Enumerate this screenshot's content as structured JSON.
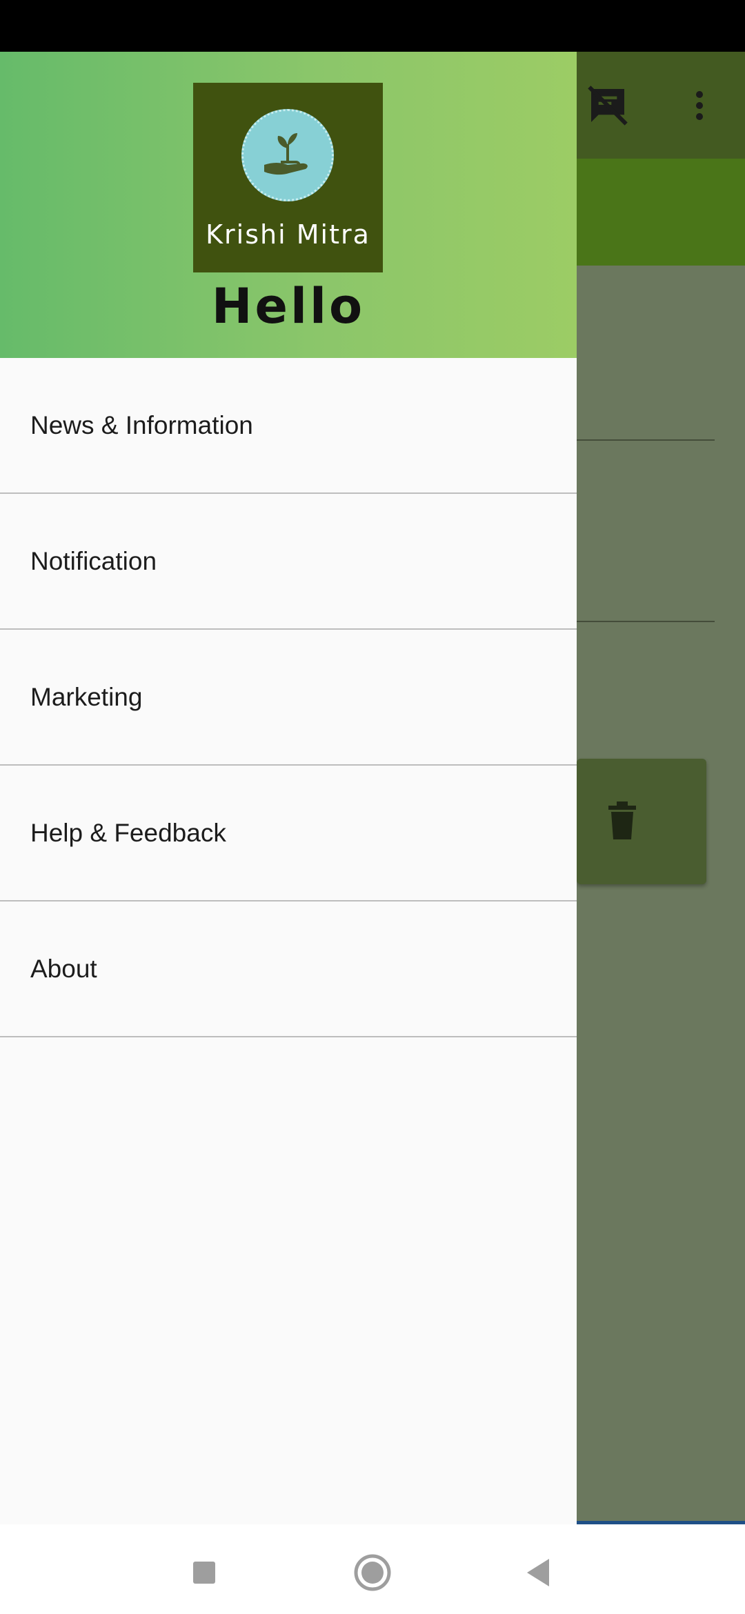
{
  "app": {
    "logo_text": "Krishi Mitra",
    "greeting": "Hello"
  },
  "drawer": {
    "items": [
      {
        "label": "News & Information"
      },
      {
        "label": "Notification"
      },
      {
        "label": "Marketing"
      },
      {
        "label": "Help & Feedback"
      },
      {
        "label": "About"
      }
    ]
  },
  "toolbar": {
    "icons": [
      "speaker-notes-off-icon",
      "more-vert-icon"
    ]
  },
  "background": {
    "icons": [
      "delete-icon"
    ]
  },
  "navigation": {
    "icons": [
      "recents-square-icon",
      "home-circle-icon",
      "back-triangle-icon"
    ]
  },
  "colors": {
    "header_gradient_start": "#66bb6a",
    "header_gradient_end": "#9ccc65",
    "toolbar": "#435a21",
    "band": "#4a7518",
    "logo_bg": "#40520f",
    "logo_circle": "#87d0d5"
  }
}
